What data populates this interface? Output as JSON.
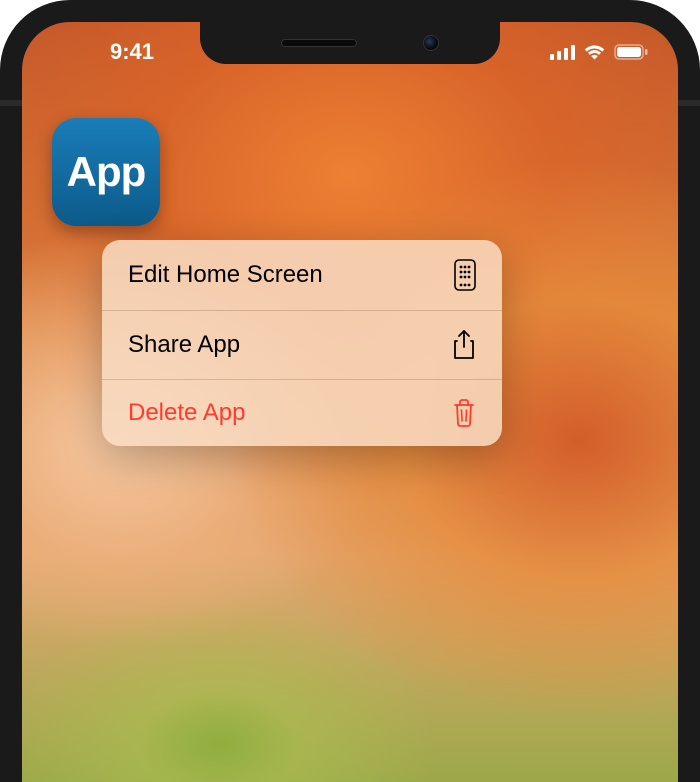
{
  "status_bar": {
    "time": "9:41"
  },
  "app": {
    "label": "App"
  },
  "context_menu": {
    "items": [
      {
        "label": "Edit Home Screen",
        "icon": "apps-icon",
        "destructive": false
      },
      {
        "label": "Share App",
        "icon": "share-icon",
        "destructive": false
      },
      {
        "label": "Delete App",
        "icon": "trash-icon",
        "destructive": true
      }
    ]
  },
  "colors": {
    "destructive": "#ff3b30",
    "app_icon_gradient_top": "#1a7db8",
    "app_icon_gradient_bottom": "#0d5a8a"
  }
}
